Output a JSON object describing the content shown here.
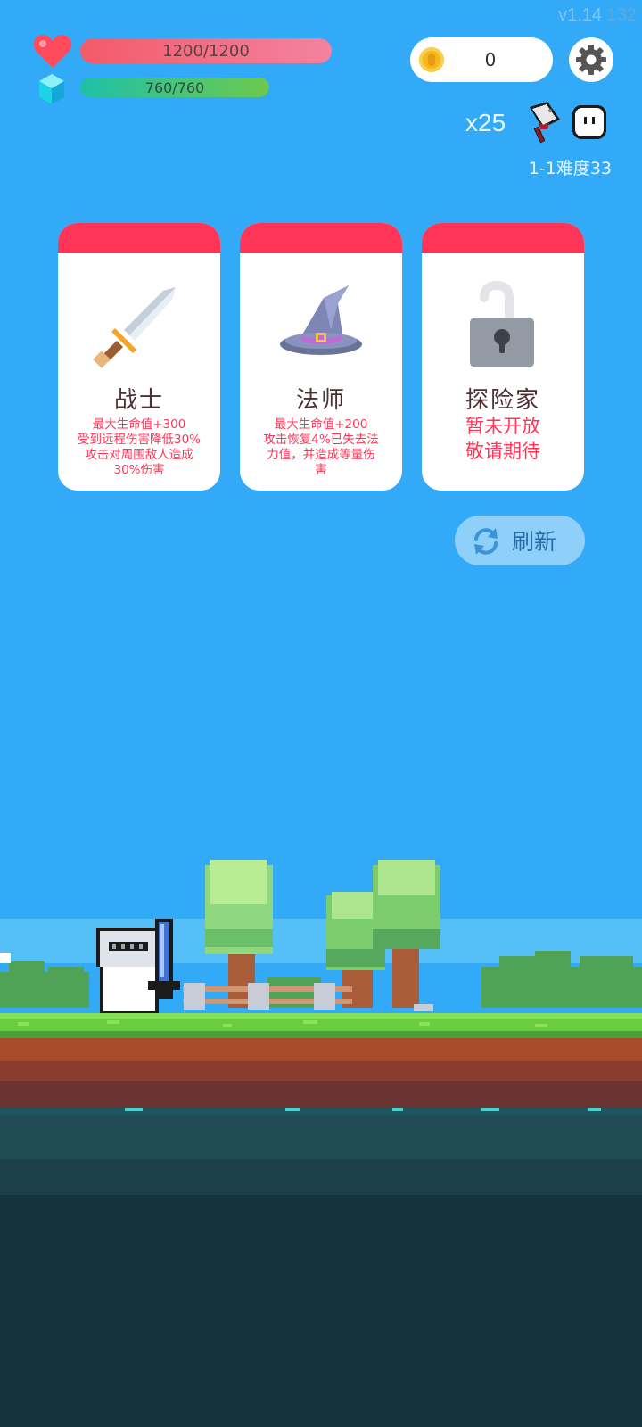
{
  "hud": {
    "version": "v1.14",
    "version_build": "132",
    "hp_text": "1200/1200",
    "hp_fraction": 1.0,
    "mp_text": "760/760",
    "mp_fraction": 1.0,
    "coins": "0",
    "kill_count": "x25",
    "stage": "1-1难度33"
  },
  "cards": [
    {
      "title": "战士",
      "desc": [
        "最大生命值+300",
        "受到远程伤害降低30%",
        "攻击对周围敌人造成",
        "30%伤害"
      ],
      "icon": "sword-icon"
    },
    {
      "title": "法师",
      "desc": [
        "最大生命值+200",
        "攻击恢复4%已失去法",
        "力值，并造成等量伤",
        "害"
      ],
      "icon": "wizard-hat-icon"
    },
    {
      "title": "探险家",
      "desc": [
        "暂未开放",
        "敬请期待"
      ],
      "icon": "padlock-icon"
    }
  ],
  "refresh_label": "刷新",
  "colors": {
    "sky": "#33aaf7",
    "card_header": "#ff3557",
    "desc_text": "#ff3557",
    "grass": "#62c33a",
    "dirt": "#a2482a",
    "deep": "#13333d"
  }
}
